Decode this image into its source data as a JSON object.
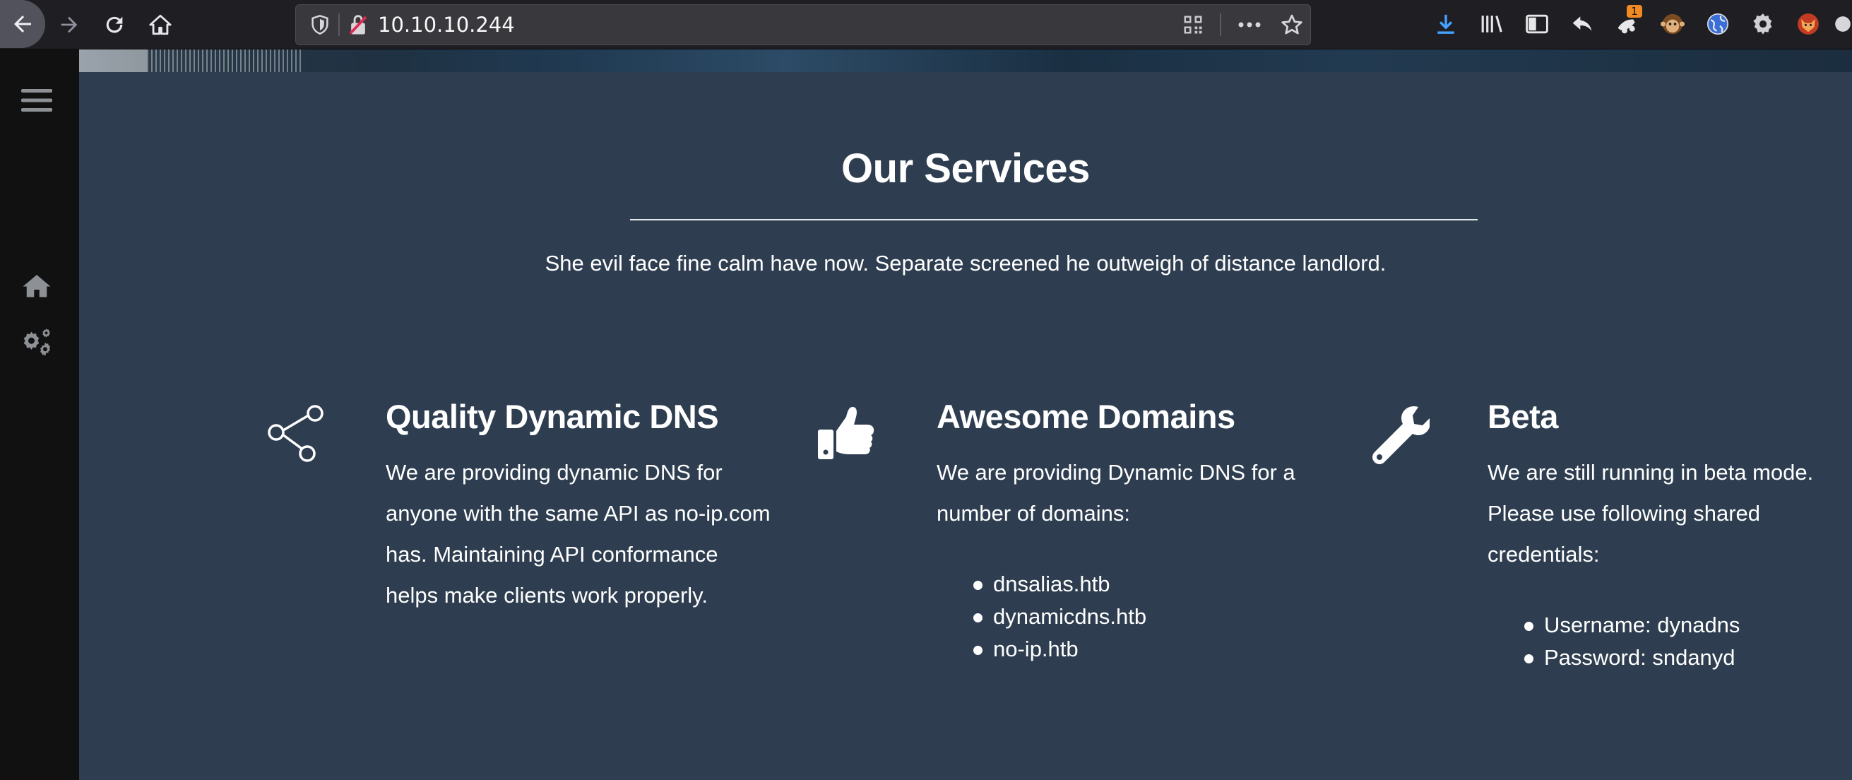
{
  "browser": {
    "url": "10.10.10.244",
    "extension_badge_count": "1",
    "icons": [
      "back-icon",
      "forward-icon",
      "reload-icon",
      "home-icon",
      "shield-icon",
      "insecure-lock-icon",
      "qr-code-icon",
      "more-icon",
      "bookmark-star-icon",
      "download-icon",
      "library-icon",
      "sidebar-icon",
      "reply-icon",
      "extension-icon",
      "monkey-extension-icon",
      "globe-extension-icon",
      "gear-extension-icon",
      "fox-extension-icon"
    ],
    "accent_color": "#45a1ff"
  },
  "sidebar": {
    "icons": [
      "hamburger-menu-icon",
      "home-icon",
      "gears-icon"
    ]
  },
  "services": {
    "title": "Our Services",
    "subtitle": "She evil face fine calm have now. Separate screened he outweigh of distance landlord.",
    "items": [
      {
        "icon": "share-icon",
        "title": "Quality Dynamic DNS",
        "lines": [
          "We are providing dynamic DNS for",
          "anyone with the same API as no-ip.com",
          "has. Maintaining API conformance",
          "helps make clients work properly."
        ],
        "list": []
      },
      {
        "icon": "thumbs-up-icon",
        "title": "Awesome Domains",
        "lines": [
          "We are providing Dynamic DNS for a",
          "number of domains:"
        ],
        "list": [
          "dnsalias.htb",
          "dynamicdns.htb",
          "no-ip.htb"
        ]
      },
      {
        "icon": "wrench-icon",
        "title": "Beta",
        "lines": [
          "We are still running in beta mode.",
          "Please use following shared",
          "credentials:"
        ],
        "list": [
          "Username: dynadns",
          "Password: sndanyd"
        ]
      }
    ]
  },
  "colors": {
    "page_background": "#2e3e50",
    "sidebar_background": "#111111",
    "text": "#ffffff"
  }
}
